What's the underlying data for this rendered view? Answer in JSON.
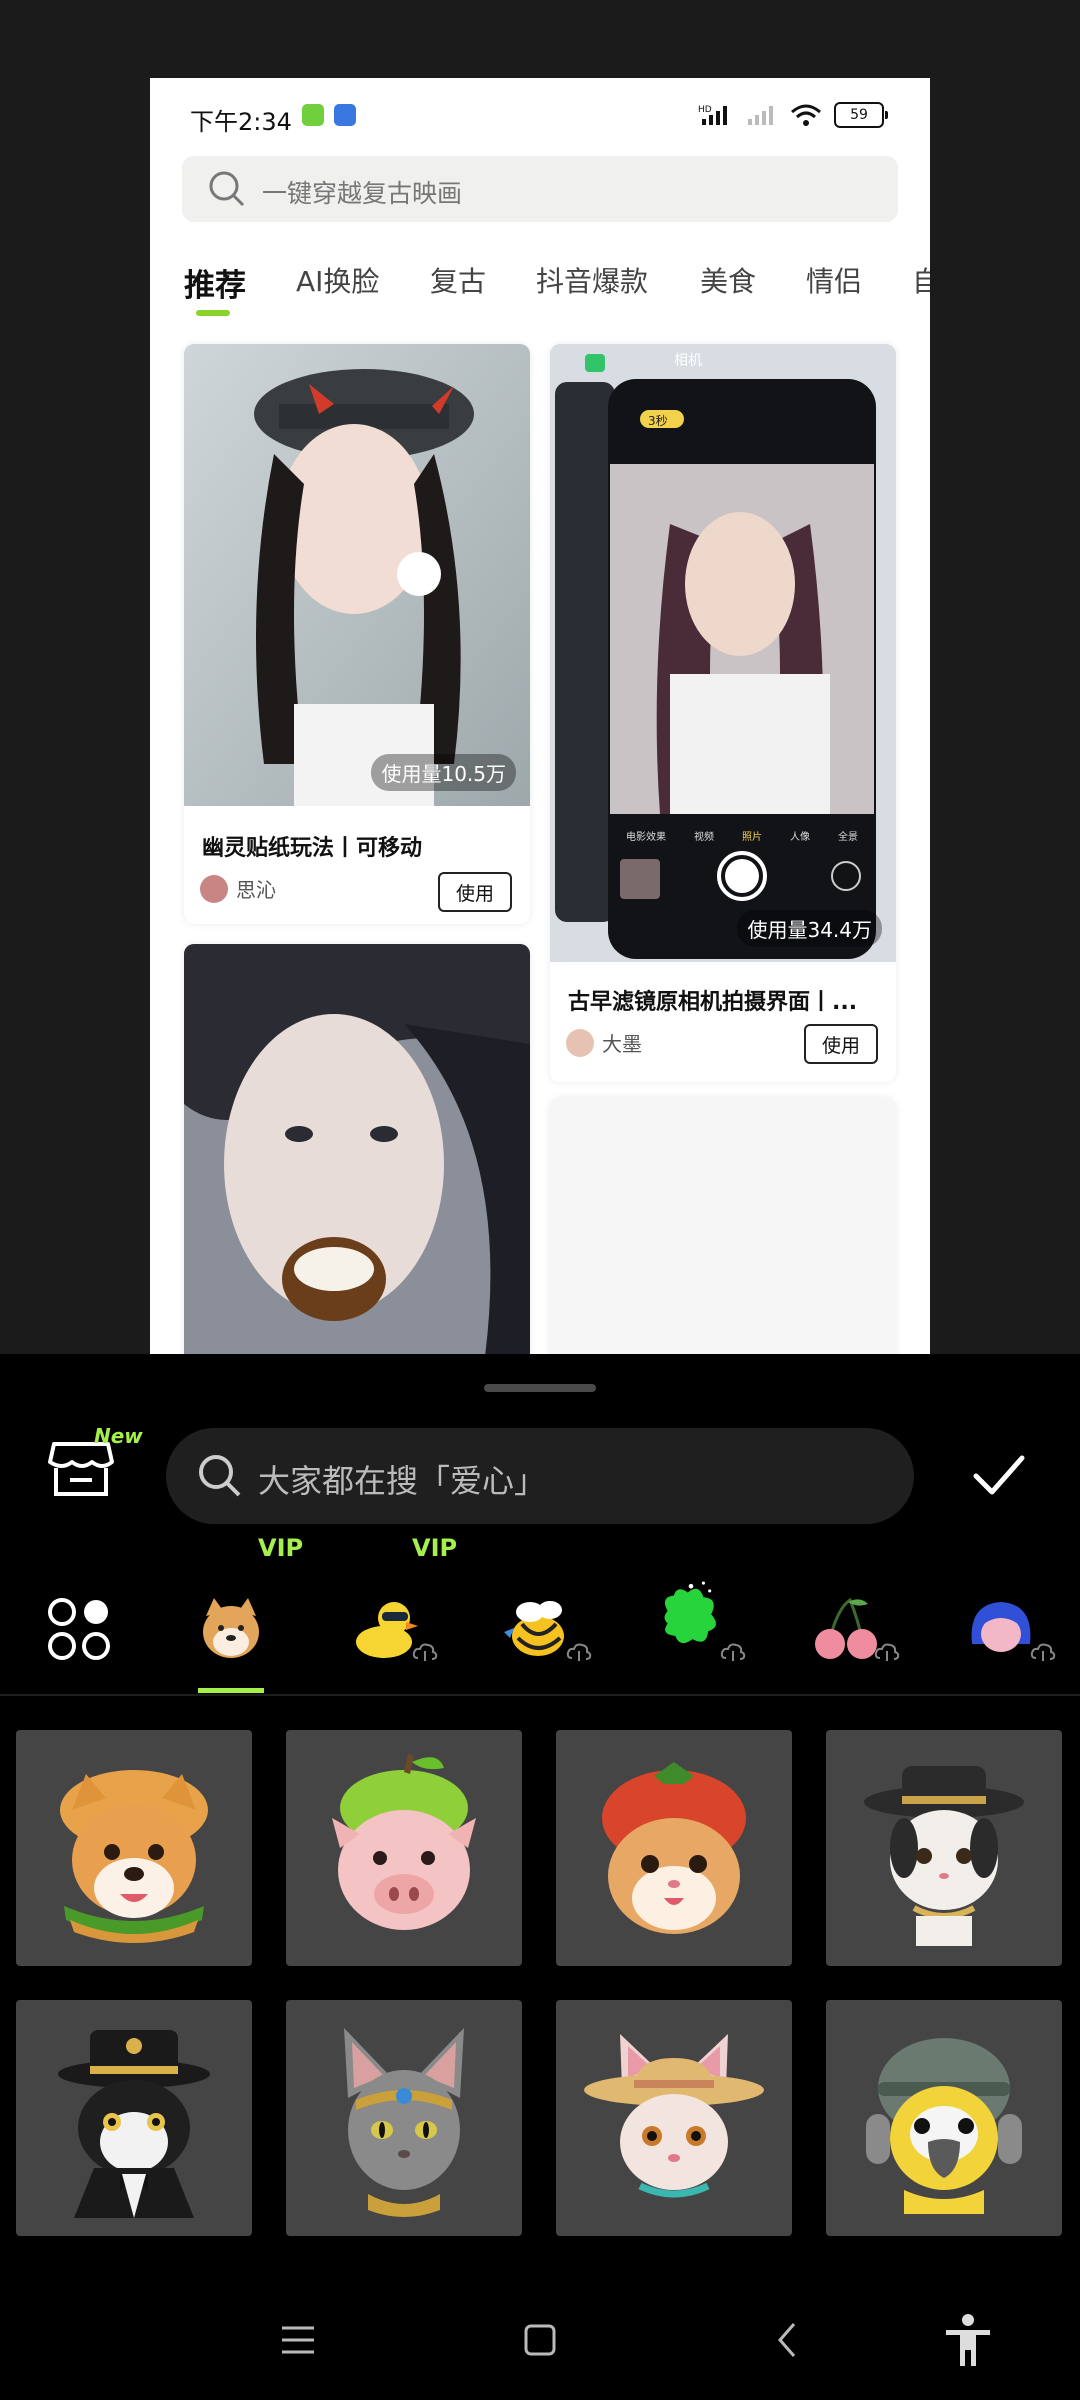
{
  "status_bar": {
    "time": "下午2:34",
    "battery": "59",
    "network": "HD"
  },
  "search": {
    "placeholder": "一键穿越复古映画"
  },
  "tabs": [
    "推荐",
    "AI换脸",
    "复古",
    "抖音爆款",
    "美食",
    "情侣",
    "自"
  ],
  "active_tab": 0,
  "cards": [
    {
      "usage": "使用量10.5万",
      "title": "幽灵贴纸玩法丨可移动",
      "author": "思沁",
      "button": "使用"
    },
    {
      "usage": "使用量34.4万",
      "title": "古早滤镜原相机拍摄界面丨...",
      "author": "大墨",
      "button": "使用",
      "camera_label": "相机",
      "timer_badge": "3秒",
      "camera_modes": [
        "电影效果",
        "视频",
        "照片",
        "人像",
        "全景"
      ]
    }
  ],
  "sticker_panel": {
    "new_badge": "New",
    "search_placeholder": "大家都在搜「爱心」",
    "categories": [
      {
        "name": "all-categories-icon"
      },
      {
        "name": "shiba-icon",
        "vip": "VIP"
      },
      {
        "name": "duck-icon",
        "vip": "VIP"
      },
      {
        "name": "bee-icon"
      },
      {
        "name": "green-blob-icon"
      },
      {
        "name": "cherry-icon"
      },
      {
        "name": "girl-icon"
      }
    ],
    "selected_category": 1,
    "items": [
      "shiba-burger-sticker",
      "pig-apple-sticker",
      "hamster-tomato-sticker",
      "cat-hat-sticker",
      "cat-tuxedo-sticker",
      "sphynx-cat-sticker",
      "cat-straw-hat-sticker",
      "parrot-helmet-sticker"
    ]
  },
  "colors": {
    "accent": "#a5f04a",
    "panel_bg": "#000000",
    "tab_indicator": "#8bd22c"
  },
  "navbar": [
    "menu-icon",
    "home-icon",
    "back-icon",
    "accessibility-icon"
  ]
}
